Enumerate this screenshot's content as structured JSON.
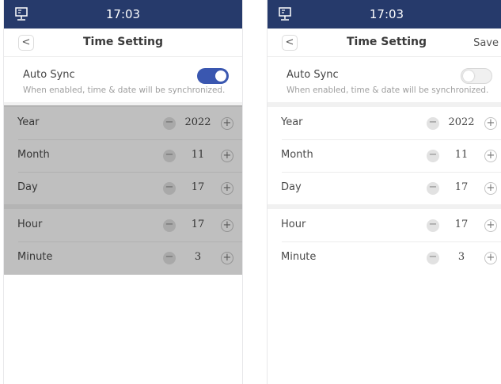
{
  "screens": [
    {
      "status": {
        "time": "17:03",
        "icon": "monitor-icon"
      },
      "nav": {
        "back_icon": "chevron-left-icon",
        "back_glyph": "<",
        "title": "Time Setting"
      },
      "auto_sync": {
        "label": "Auto Sync",
        "description": "When enabled, time & date will be synchronized.",
        "enabled": true
      },
      "date_rows": [
        {
          "label": "Year",
          "value": "2022"
        },
        {
          "label": "Month",
          "value": "11"
        },
        {
          "label": "Day",
          "value": "17"
        }
      ],
      "time_rows": [
        {
          "label": "Hour",
          "value": "17"
        },
        {
          "label": "Minute",
          "value": "3"
        }
      ],
      "stepper": {
        "minus_glyph": "−",
        "plus_glyph": "+"
      },
      "fields_disabled": true
    },
    {
      "status": {
        "time": "17:03",
        "icon": "monitor-icon"
      },
      "nav": {
        "back_icon": "chevron-left-icon",
        "back_glyph": "<",
        "title": "Time Setting",
        "save_label": "Save"
      },
      "auto_sync": {
        "label": "Auto Sync",
        "description": "When enabled, time & date will be synchronized.",
        "enabled": false
      },
      "date_rows": [
        {
          "label": "Year",
          "value": "2022"
        },
        {
          "label": "Month",
          "value": "11"
        },
        {
          "label": "Day",
          "value": "17"
        }
      ],
      "time_rows": [
        {
          "label": "Hour",
          "value": "17"
        },
        {
          "label": "Minute",
          "value": "3"
        }
      ],
      "stepper": {
        "minus_glyph": "−",
        "plus_glyph": "+"
      },
      "fields_disabled": false
    }
  ],
  "colors": {
    "status_bar": "#263a6b",
    "toggle_on": "#3a57b0",
    "toggle_off": "#f0f0f0",
    "disabled_overlay": "rgba(0,0,0,0.25)"
  }
}
